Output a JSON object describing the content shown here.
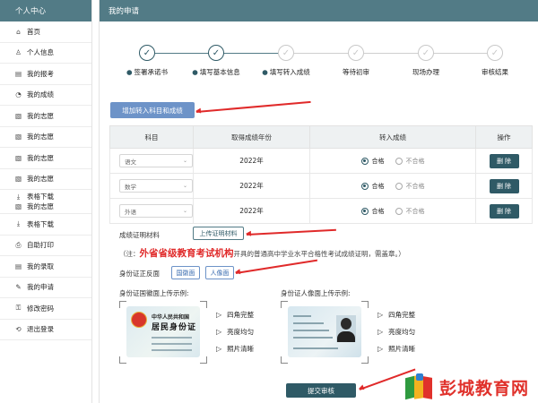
{
  "sidebar": {
    "title": "个人中心",
    "items": [
      {
        "label": "首页",
        "icon": "home-icon",
        "glyph": "⌂"
      },
      {
        "label": "个人信息",
        "icon": "user-info-icon",
        "glyph": "♙"
      },
      {
        "label": "我的报考",
        "icon": "registration-icon",
        "glyph": "▤"
      },
      {
        "label": "我的成绩",
        "icon": "score-chart-icon",
        "glyph": "◔"
      },
      {
        "label": "我的志愿",
        "icon": "wish-doc-icon",
        "glyph": "▧"
      },
      {
        "label": "我的志愿",
        "icon": "wish-doc-icon",
        "glyph": "▧"
      },
      {
        "label": "我的志愿",
        "icon": "wish-doc-icon",
        "glyph": "▧"
      },
      {
        "label": "我的志愿",
        "icon": "wish-doc-icon",
        "glyph": "▧"
      }
    ],
    "download_group": {
      "label1": "表格下载",
      "label2": "我的志愿",
      "icon1": "download-icon",
      "icon2": "wish-doc-icon"
    },
    "items2": [
      {
        "label": "表格下载",
        "icon": "download-icon",
        "glyph": "⤓"
      },
      {
        "label": "自助打印",
        "icon": "printer-icon",
        "glyph": "⎙"
      },
      {
        "label": "我的录取",
        "icon": "admission-icon",
        "glyph": "▤"
      },
      {
        "label": "我的申请",
        "icon": "application-icon",
        "glyph": "✎"
      },
      {
        "label": "修改密码",
        "icon": "lock-icon",
        "glyph": "🔒"
      },
      {
        "label": "退出登录",
        "icon": "logout-icon",
        "glyph": "⟲"
      }
    ]
  },
  "main": {
    "title": "我的申请",
    "steps": [
      {
        "label": "签署承诺书",
        "state": "done"
      },
      {
        "label": "填写基本信息",
        "state": "done"
      },
      {
        "label": "填写转入成绩",
        "state": "pending"
      },
      {
        "label": "等待初审",
        "state": "pending"
      },
      {
        "label": "现场办理",
        "state": "pending"
      },
      {
        "label": "审核结果",
        "state": "pending"
      }
    ],
    "add_button": "增加转入科目和成绩",
    "table": {
      "headers": [
        "科目",
        "取得成绩年份",
        "转入成绩",
        "操作"
      ],
      "rows": [
        {
          "subject": "语文",
          "year": "2022年",
          "pass": "合格",
          "fail": "不合格",
          "action": "删 除"
        },
        {
          "subject": "数学",
          "year": "2022年",
          "pass": "合格",
          "fail": "不合格",
          "action": "删 除"
        },
        {
          "subject": "外语",
          "year": "2022年",
          "pass": "合格",
          "fail": "不合格",
          "action": "删 除"
        }
      ]
    },
    "material": {
      "label": "成绩证明材料",
      "upload_button": "上传证明材料",
      "note_prefix": "（注：",
      "note_highlight": "外省省级教育考试机构",
      "note_suffix": "开具的普通高中学业水平合格性考试成绩证明，需盖章。）"
    },
    "idcard": {
      "label": "身份证正反面",
      "emblem_button": "国徽面",
      "portrait_button": "人像面",
      "emblem_sample_title": "身份证国徽面上传示例:",
      "portrait_sample_title": "身份证人像面上传示例:",
      "card_line1": "中华人民共和国",
      "card_line2": "居民身份证",
      "checks": [
        "四角完整",
        "亮度均匀",
        "照片清晰"
      ]
    },
    "submit_button": "提交审核"
  },
  "logo": {
    "text": "彭城教育网"
  },
  "colors": {
    "header": "#527b86",
    "primary": "#2f5a66",
    "accent_blue": "#6d93c8",
    "annotation_red": "#e02a2a"
  }
}
